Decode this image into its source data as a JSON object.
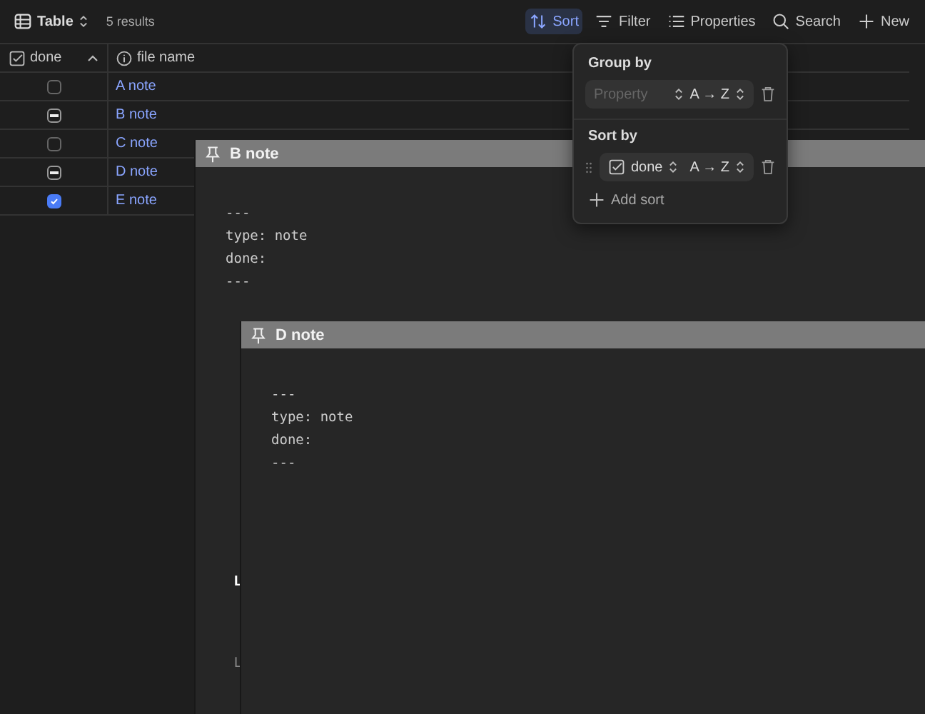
{
  "toolbar": {
    "view": "Table",
    "count": "5 results",
    "actions": [
      {
        "kind": "sort",
        "label": "Sort",
        "selected": true
      },
      {
        "kind": "filter",
        "label": "Filter",
        "selected": false
      },
      {
        "kind": "properties",
        "label": "Properties",
        "selected": false
      },
      {
        "kind": "search",
        "label": "Search",
        "selected": false
      },
      {
        "kind": "new",
        "label": "New",
        "selected": false
      }
    ]
  },
  "table": {
    "columns": [
      {
        "label": "done",
        "kind": "checkbox"
      },
      {
        "label": "file name",
        "kind": "info"
      }
    ],
    "rows": [
      {
        "checked": false,
        "name": "A note"
      },
      {
        "indeterminate": true,
        "name": "B note"
      },
      {
        "checked": false,
        "name": "C note"
      },
      {
        "indeterminate": true,
        "name": "D note"
      },
      {
        "checked": true,
        "name": "E note"
      }
    ]
  },
  "sort_popover": {
    "group_title": "Group by",
    "group_property_placeholder": "Property",
    "group_order": "A → Z",
    "sort_title": "Sort by",
    "sort_property": "done",
    "sort_order": "A → Z",
    "add_label": "Add sort"
  },
  "windows": [
    {
      "title": "B note",
      "lines": [
        "---",
        "type: note",
        "done:",
        "---"
      ],
      "below_text": [
        "L",
        "L"
      ]
    },
    {
      "title": "D note",
      "lines": [
        "---",
        "type: note",
        "done:",
        "---"
      ]
    }
  ]
}
